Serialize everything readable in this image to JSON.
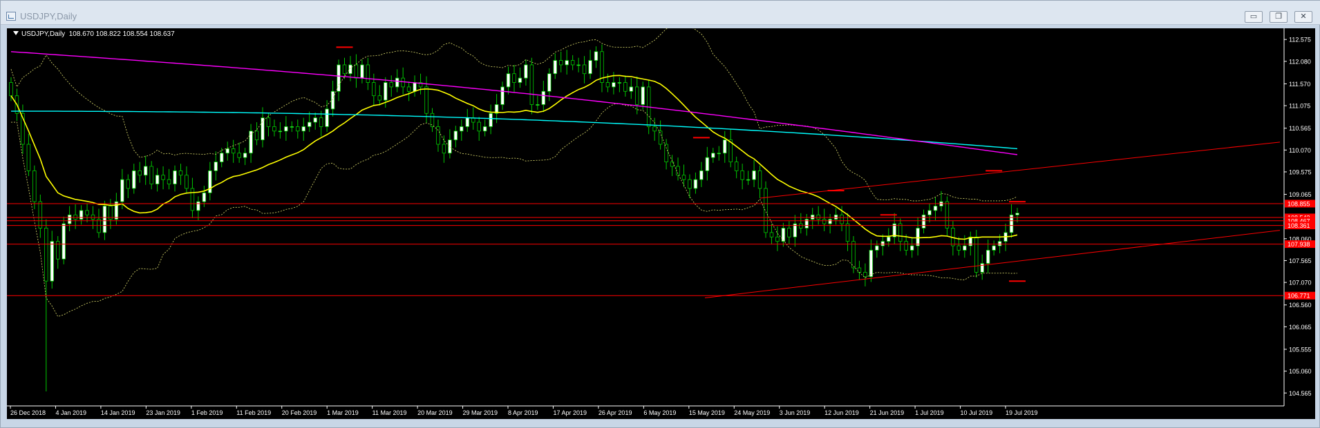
{
  "window": {
    "title": "USDJPY,Daily",
    "controls": {
      "minimize": "▭",
      "restore": "❐",
      "close": "✕"
    }
  },
  "symbol_info": {
    "symbol_timeframe": "USDJPY,Daily",
    "ohlc": "108.670 108.822 108.554 108.637"
  },
  "price_axis": {
    "labels": [
      "112.575",
      "112.080",
      "111.570",
      "111.075",
      "110.565",
      "110.070",
      "109.575",
      "109.065",
      "108.060",
      "107.565",
      "107.070",
      "106.560",
      "106.065",
      "105.555",
      "105.060",
      "104.565"
    ]
  },
  "price_tags": [
    {
      "text": "108.855",
      "price": 108.855
    },
    {
      "text": "108.543",
      "price": 108.543
    },
    {
      "text": "108.467",
      "price": 108.467
    },
    {
      "text": "108.361",
      "price": 108.361
    },
    {
      "text": "107.938",
      "price": 107.938
    },
    {
      "text": "106.771",
      "price": 106.771
    }
  ],
  "time_axis": {
    "labels": [
      "26 Dec 2018",
      "4 Jan 2019",
      "14 Jan 2019",
      "23 Jan 2019",
      "1 Feb 2019",
      "11 Feb 2019",
      "20 Feb 2019",
      "1 Mar 2019",
      "11 Mar 2019",
      "20 Mar 2019",
      "29 Mar 2019",
      "8 Apr 2019",
      "17 Apr 2019",
      "26 Apr 2019",
      "6 May 2019",
      "15 May 2019",
      "24 May 2019",
      "3 Jun 2019",
      "12 Jun 2019",
      "21 Jun 2019",
      "1 Jul 2019",
      "10 Jul 2019",
      "19 Jul 2019"
    ]
  },
  "colors": {
    "background": "#000000",
    "bull_candle": "#ffffff",
    "bear_candle": "#000000",
    "candle_outline": "#00cc00",
    "ma_fast": "#ffff00",
    "ma_slow": "#00ffff",
    "ma_slow2": "#ff00ff",
    "bollinger": "#cccc66",
    "levels": "#ff0000",
    "axis_text": "#ffffff"
  },
  "chart_data": {
    "type": "candlestick",
    "symbol": "USDJPY",
    "timeframe": "Daily",
    "ylim": [
      104.35,
      112.75
    ],
    "horizontal_levels": [
      108.855,
      108.543,
      108.467,
      108.361,
      107.938,
      106.771
    ],
    "closes": [
      111.3,
      110.9,
      110.2,
      109.6,
      108.9,
      108.3,
      107.1,
      108.0,
      107.6,
      108.4,
      108.6,
      108.5,
      108.7,
      108.6,
      108.5,
      108.2,
      108.8,
      108.5,
      108.9,
      109.4,
      109.2,
      109.6,
      109.5,
      109.7,
      109.3,
      109.5,
      109.4,
      109.3,
      109.6,
      109.5,
      109.2,
      108.7,
      108.9,
      109.1,
      109.6,
      109.8,
      110.0,
      110.1,
      110.0,
      109.9,
      110.0,
      110.5,
      110.3,
      110.8,
      110.6,
      110.5,
      110.5,
      110.6,
      110.6,
      110.5,
      110.6,
      110.7,
      110.8,
      110.6,
      111.0,
      111.4,
      112.0,
      111.8,
      112.0,
      111.7,
      112.0,
      111.6,
      111.3,
      111.2,
      111.6,
      111.5,
      111.7,
      111.5,
      111.4,
      111.6,
      111.5,
      110.9,
      110.6,
      110.2,
      110.0,
      110.3,
      110.5,
      110.6,
      110.8,
      110.7,
      110.5,
      110.6,
      110.9,
      111.1,
      111.5,
      111.8,
      111.6,
      111.7,
      112.0,
      111.1,
      111.1,
      111.4,
      111.8,
      112.1,
      112.0,
      112.1,
      112.0,
      112.0,
      111.8,
      112.1,
      112.3,
      111.6,
      111.5,
      111.6,
      111.6,
      111.4,
      111.5,
      111.1,
      111.5,
      110.6,
      110.5,
      110.2,
      109.8,
      109.7,
      109.5,
      109.4,
      109.2,
      109.4,
      109.6,
      109.9,
      110.0,
      110.0,
      110.3,
      109.8,
      109.6,
      109.4,
      109.4,
      109.6,
      109.2,
      108.2,
      108.1,
      108.0,
      108.3,
      108.1,
      108.4,
      108.3,
      108.5,
      108.6,
      108.5,
      108.4,
      108.5,
      108.6,
      108.4,
      108.0,
      107.4,
      107.3,
      107.2,
      107.8,
      107.9,
      108.0,
      108.1,
      108.4,
      108.0,
      107.8,
      107.9,
      108.3,
      108.6,
      108.7,
      108.8,
      108.9,
      108.3,
      107.9,
      107.8,
      107.9,
      108.1,
      107.3,
      107.5,
      107.8,
      107.9,
      108.0,
      108.2,
      108.6,
      108.64
    ]
  }
}
